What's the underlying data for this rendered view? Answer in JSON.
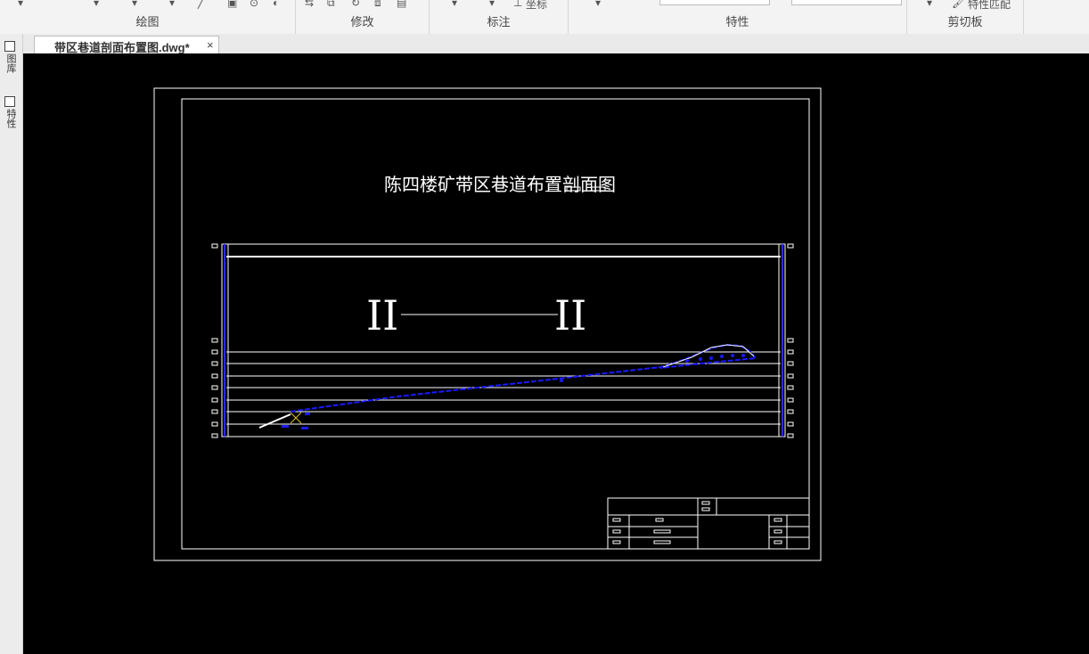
{
  "ribbon": {
    "groups": [
      {
        "name": "draw",
        "label": "绘图"
      },
      {
        "name": "modify",
        "label": "修改"
      },
      {
        "name": "annotate",
        "label": "标注"
      },
      {
        "name": "properties",
        "label": "特性"
      },
      {
        "name": "clipboard",
        "label": "剪切板"
      }
    ],
    "coordinate_label": "坐标",
    "match_properties_label": "特性匹配"
  },
  "document": {
    "tab_title": "带区巷道剖面布置图.dwg*",
    "close_glyph": "×"
  },
  "side_panel": {
    "tabs": [
      {
        "label": "图库",
        "icon": "library-icon"
      },
      {
        "label": "特性",
        "icon": "properties-icon"
      }
    ]
  },
  "drawing": {
    "title": "陈四楼矿带区巷道布置剖面图",
    "section_mark_left": "II",
    "section_mark_right": "II"
  },
  "colors": {
    "ribbon_bg": "#f3f3f3",
    "canvas_bg": "#000000",
    "line_white": "#ffffff",
    "roadway_blue": "#1a1aff"
  }
}
